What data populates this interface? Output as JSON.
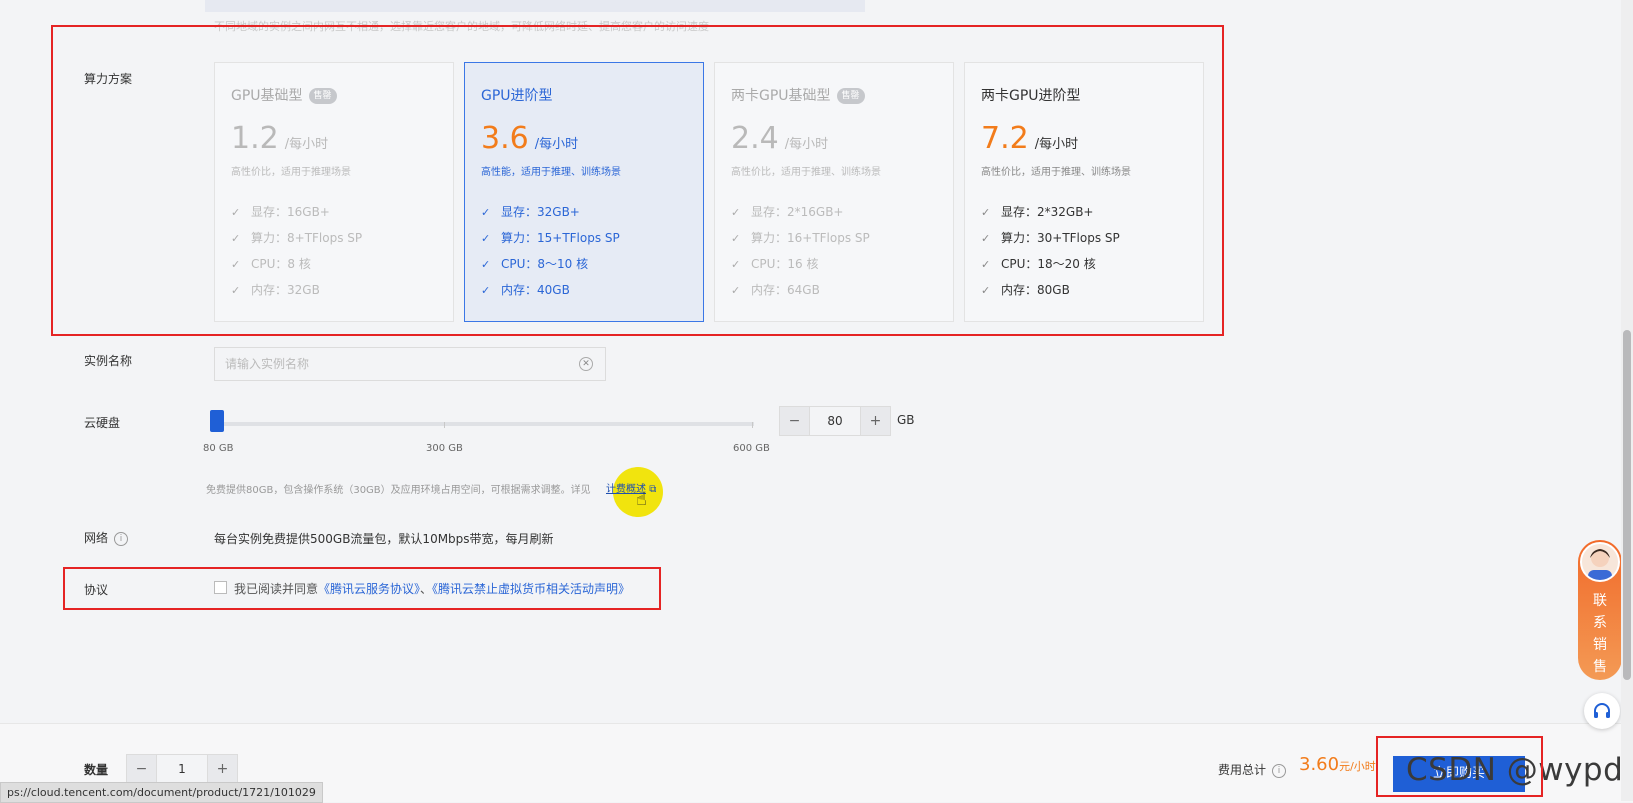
{
  "top_hint": "不同地域的实例之间内网互不相通，选择靠近您客户的地域，可降低网络时延、提高您客户的访问速度",
  "plan_section": {
    "label": "算力方案",
    "plans": [
      {
        "name": "GPU基础型",
        "badge": "售罄",
        "price": "1.2",
        "unit": "/每小时",
        "desc": "高性价比，适用于推理场景",
        "specs": [
          "显存：16GB+",
          "算力：8+TFlops SP",
          "CPU：8 核",
          "内存：32GB"
        ]
      },
      {
        "name": "GPU进阶型",
        "badge": "",
        "price": "3.6",
        "unit": "/每小时",
        "desc": "高性能，适用于推理、训练场景",
        "specs": [
          "显存：32GB+",
          "算力：15+TFlops SP",
          "CPU：8～10 核",
          "内存：40GB"
        ]
      },
      {
        "name": "两卡GPU基础型",
        "badge": "售罄",
        "price": "2.4",
        "unit": "/每小时",
        "desc": "高性价比，适用于推理、训练场景",
        "specs": [
          "显存：2*16GB+",
          "算力：16+TFlops SP",
          "CPU：16 核",
          "内存：64GB"
        ]
      },
      {
        "name": "两卡GPU进阶型",
        "badge": "",
        "price": "7.2",
        "unit": "/每小时",
        "desc": "高性价比，适用于推理、训练场景",
        "specs": [
          "显存：2*32GB+",
          "算力：30+TFlops SP",
          "CPU：18～20 核",
          "内存：80GB"
        ]
      }
    ]
  },
  "instance_name": {
    "label": "实例名称",
    "placeholder": "请输入实例名称",
    "value": ""
  },
  "disk": {
    "label": "云硬盘",
    "tick_labels": [
      "80 GB",
      "300 GB",
      "600 GB"
    ],
    "value": "80",
    "unit": "GB",
    "minus": "−",
    "plus": "+",
    "note": "免费提供80GB，包含操作系统（30GB）及应用环境占用空间，可根据需求调整。详见",
    "note_link": "计费概述"
  },
  "network": {
    "label": "网络",
    "text": "每台实例免费提供500GB流量包，默认10Mbps带宽，每月刷新"
  },
  "agreement": {
    "label": "协议",
    "prefix": "我已阅读并同意",
    "link1": "《腾讯云服务协议》",
    "sep": "、",
    "link2": "《腾讯云禁止虚拟货币相关活动声明》"
  },
  "footer": {
    "qty_label": "数量",
    "qty_value": "1",
    "minus": "−",
    "plus": "+",
    "total_label": "费用总计",
    "total_price": "3.60",
    "total_unit": "元/小时",
    "buy_label": "立即购买",
    "status_url": "ps://cloud.tencent.com/document/product/1721/101029",
    "watermark": "CSDN @wypdao"
  },
  "contact": {
    "chars": [
      "联",
      "系",
      "销",
      "售"
    ]
  },
  "colors": {
    "accent": "#1f5fd6",
    "price": "#f27c1b",
    "annotation": "#e52424",
    "highlight": "#f1e40e"
  }
}
